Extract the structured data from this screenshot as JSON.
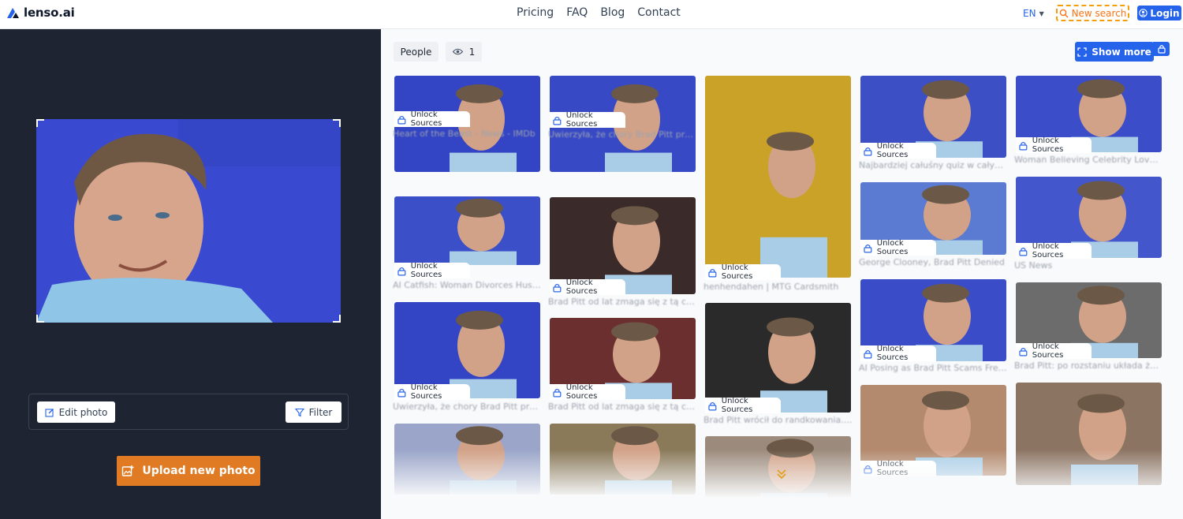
{
  "header": {
    "brand": "lenso.ai",
    "nav": [
      "Pricing",
      "FAQ",
      "Blog",
      "Contact"
    ],
    "language": "EN",
    "new_search_label": "New search",
    "login_label": "Login"
  },
  "left_panel": {
    "edit_label": "Edit photo",
    "filter_label": "Filter",
    "upload_label": "Upload new photo"
  },
  "results": {
    "category_chip": "People",
    "views_count": "1",
    "show_more_label": "Show more",
    "unlock_label": "Unlock Sources",
    "columns": [
      [
        {
          "caption": "Heart of the Beast - News - IMDb",
          "bg": "#3344c4"
        },
        {
          "caption": "AI Catfish: Woman Divorces Husband",
          "bg": "#3a4fc8"
        },
        {
          "caption": "Uwierzyła, że chory Brad Pitt prosi o pieniądze",
          "bg": "#3344c4"
        },
        {
          "caption": "",
          "bg": "#9aa5c9"
        }
      ],
      [
        {
          "caption": "Uwierzyła, że chory Brad Pitt prosi o pieniądze",
          "bg": "#3849c6"
        },
        {
          "caption": "Brad Pitt od lat zmaga się z tą chorobą",
          "bg": "#3a2a2a"
        },
        {
          "caption": "Brad Pitt od lat zmaga się z tą chorobą",
          "bg": "#6b2f2f"
        },
        {
          "caption": "",
          "bg": "#8a7a5a"
        }
      ],
      [
        {
          "caption": "henhendahen | MTG Cardsmith",
          "bg": "#c9a227"
        },
        {
          "caption": "Brad Pitt wrócił do randkowania. Kim jest",
          "bg": "#2a2a2a"
        },
        {
          "caption": "",
          "bg": "#9c8b7c"
        }
      ],
      [
        {
          "caption": "Najbardziej całuśny quiz w całym internecie",
          "bg": "#3d4fc4"
        },
        {
          "caption": "George Clooney, Brad Pitt Denied",
          "bg": "#5a7bd1"
        },
        {
          "caption": "AI Posing as Brad Pitt Scams French Woman",
          "bg": "#3a4cc8"
        },
        {
          "caption": "",
          "bg": "#b38a6e"
        }
      ],
      [
        {
          "caption": "Woman Believing Celebrity Love Affair",
          "bg": "#3b4dc8"
        },
        {
          "caption": "US News",
          "bg": "#4456cc"
        },
        {
          "caption": "Brad Pitt: po rozstaniu układa życie",
          "bg": "#6c6c6c"
        },
        {
          "caption": "",
          "bg": "#8c7463"
        }
      ]
    ]
  },
  "colors": {
    "accent_blue": "#2563eb",
    "accent_orange": "#e07b24",
    "panel_dark": "#1e2432"
  }
}
